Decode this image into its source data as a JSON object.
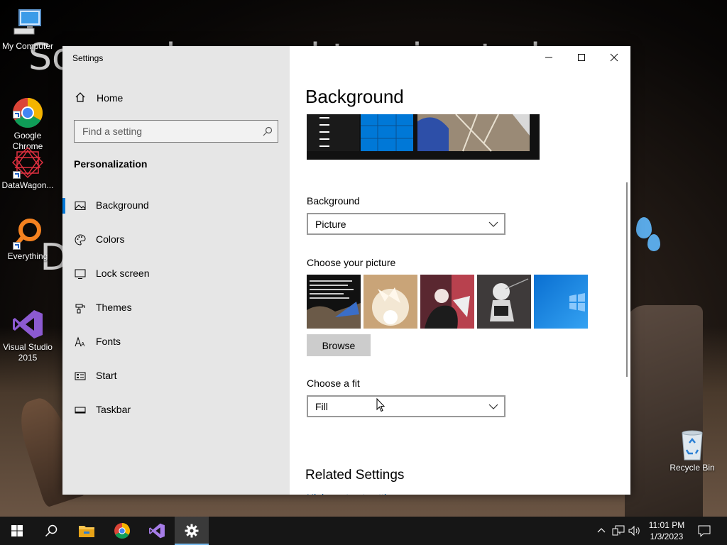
{
  "desktop": {
    "wallpaper_text": "So much sexual tension today\n                                              for\n                                             ke.\n D",
    "icons": [
      {
        "label": "My Computer"
      },
      {
        "label": "Google\nChrome"
      },
      {
        "label": "DataWagon..."
      },
      {
        "label": "Everything"
      },
      {
        "label": "Visual Studio\n2015"
      },
      {
        "label": "Recycle Bin"
      }
    ]
  },
  "window": {
    "title": "Settings",
    "minimize": "—",
    "maximize": "☐",
    "close": "✕"
  },
  "sidebar": {
    "home_label": "Home",
    "search_placeholder": "Find a setting",
    "section_title": "Personalization",
    "items": [
      {
        "label": "Background",
        "icon": "picture-icon",
        "active": true
      },
      {
        "label": "Colors",
        "icon": "palette-icon"
      },
      {
        "label": "Lock screen",
        "icon": "lock-screen-icon"
      },
      {
        "label": "Themes",
        "icon": "themes-icon"
      },
      {
        "label": "Fonts",
        "icon": "fonts-icon"
      },
      {
        "label": "Start",
        "icon": "start-icon"
      },
      {
        "label": "Taskbar",
        "icon": "taskbar-icon"
      }
    ]
  },
  "content": {
    "heading": "Background",
    "background_label": "Background",
    "background_value": "Picture",
    "choose_picture_label": "Choose your picture",
    "browse_label": "Browse",
    "fit_label": "Choose a fit",
    "fit_value": "Fill",
    "related_heading": "Related Settings",
    "related_link_peek": "High contrast settings"
  },
  "taskbar": {
    "time": "11:01 PM",
    "date": "1/3/2023",
    "apps": [
      "start-icon",
      "search-icon",
      "file-explorer-icon",
      "chrome-icon",
      "visual-studio-icon",
      "settings-icon"
    ],
    "tray": [
      "chevron-up-icon",
      "network-icon",
      "volume-icon",
      "action-center-icon"
    ]
  },
  "colors": {
    "accent": "#0078d7",
    "sidebar_bg": "#e6e6e6",
    "taskbar_bg": "#161616"
  }
}
